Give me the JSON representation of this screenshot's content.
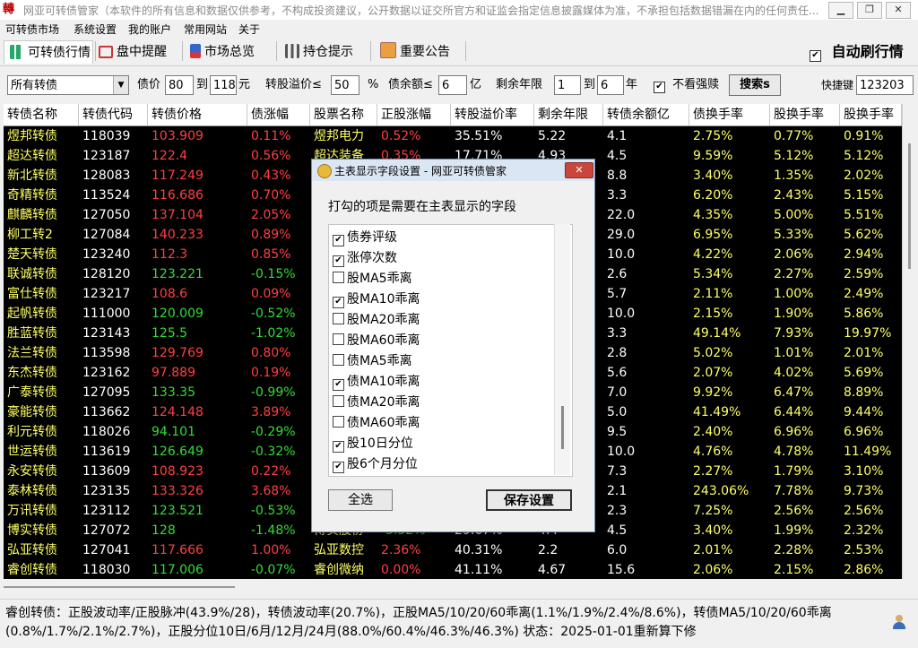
{
  "window": {
    "app_icon_text": "轉",
    "title": "网亚可转债管家（本软件的所有信息和数据仅供参考，不构成投资建议，公开数据以证交所官方和证监会指定信息披露媒体为准，不承担包括数据错漏在内的任何责任..."
  },
  "menu": [
    "可转债市场",
    "系统设置",
    "我的账户",
    "常用网站",
    "关于"
  ],
  "tabs": [
    {
      "label": "可转债行情",
      "icon": "bar-chart-icon"
    },
    {
      "label": "盘中提醒",
      "icon": "monitor-alert-icon"
    },
    {
      "label": "市场总览",
      "icon": "market-chart-icon"
    },
    {
      "label": "持仓提示",
      "icon": "portfolio-icon"
    },
    {
      "label": "重要公告",
      "icon": "announcement-icon"
    }
  ],
  "auto_refresh": {
    "label": "自动刷行情",
    "checked": true
  },
  "filters": {
    "category": "所有转债",
    "price_label": "债价",
    "price_min": "80",
    "price_to": "到",
    "price_max": "118",
    "price_unit": "元",
    "premium_label": "转股溢价≤",
    "premium_value": "50",
    "premium_unit": "%",
    "balance_label": "债余额≤",
    "balance_value": "6",
    "balance_unit": "亿",
    "years_label": "剩余年限",
    "years_min": "1",
    "years_to": "到",
    "years_max": "6",
    "years_unit": "年",
    "exclude_redeem_label": "不看强赎",
    "exclude_redeem_checked": true,
    "search_button": "搜索s",
    "shortcut_label": "快捷键",
    "shortcut_value": "123203"
  },
  "table": {
    "columns": [
      "转债名称",
      "转债代码",
      "转债价格",
      "债涨幅",
      "股票名称",
      "正股涨幅",
      "转股溢价率",
      "剩余年限",
      "转债余额亿",
      "债换手率",
      "股换手率",
      "股换手率"
    ],
    "rows": [
      [
        "煜邦转债",
        "118039",
        "103.909",
        "0.11%",
        "煜邦电力",
        "0.52%",
        "35.51%",
        "5.22",
        "4.1",
        "2.75%",
        "0.77%",
        "0.91%"
      ],
      [
        "超达转债",
        "123187",
        "122.4",
        "0.56%",
        "超达装备",
        "0.35%",
        "17.71%",
        "4.93",
        "4.5",
        "9.59%",
        "5.12%",
        "5.12%"
      ],
      [
        "新北转债",
        "128083",
        "117.249",
        "0.43%",
        "",
        "",
        "",
        "",
        "8.8",
        "3.40%",
        "1.35%",
        "2.02%"
      ],
      [
        "奇精转债",
        "113524",
        "116.686",
        "0.70%",
        "",
        "",
        "",
        "",
        "3.3",
        "6.20%",
        "2.43%",
        "5.15%"
      ],
      [
        "麒麟转债",
        "127050",
        "137.104",
        "2.05%",
        "",
        "",
        "",
        "",
        "22.0",
        "4.35%",
        "5.00%",
        "5.51%"
      ],
      [
        "柳工转2",
        "127084",
        "140.233",
        "0.89%",
        "",
        "",
        "",
        "",
        "29.0",
        "6.95%",
        "5.33%",
        "5.62%"
      ],
      [
        "楚天转债",
        "123240",
        "112.3",
        "0.85%",
        "",
        "",
        "",
        "",
        "10.0",
        "4.22%",
        "2.06%",
        "2.94%"
      ],
      [
        "联诚转债",
        "128120",
        "123.221",
        "-0.15%",
        "",
        "",
        "",
        "",
        "2.6",
        "5.34%",
        "2.27%",
        "2.59%"
      ],
      [
        "富仕转债",
        "123217",
        "108.6",
        "0.09%",
        "",
        "",
        "",
        "",
        "5.7",
        "2.11%",
        "1.00%",
        "2.49%"
      ],
      [
        "起帆转债",
        "111000",
        "120.009",
        "-0.52%",
        "",
        "",
        "",
        "",
        "10.0",
        "2.15%",
        "1.90%",
        "5.86%"
      ],
      [
        "胜蓝转债",
        "123143",
        "125.5",
        "-1.02%",
        "",
        "",
        "",
        "",
        "3.3",
        "49.14%",
        "7.93%",
        "19.97%"
      ],
      [
        "法兰转债",
        "113598",
        "129.769",
        "0.80%",
        "",
        "",
        "",
        "",
        "2.8",
        "5.02%",
        "1.01%",
        "2.01%"
      ],
      [
        "东杰转债",
        "123162",
        "97.889",
        "0.19%",
        "",
        "",
        "",
        "",
        "5.6",
        "2.07%",
        "4.02%",
        "5.69%"
      ],
      [
        "广泰转债",
        "127095",
        "133.35",
        "-0.99%",
        "",
        "",
        "",
        "",
        "7.0",
        "9.92%",
        "6.47%",
        "8.89%"
      ],
      [
        "豪能转债",
        "113662",
        "124.148",
        "3.89%",
        "",
        "",
        "",
        "",
        "5.0",
        "41.49%",
        "6.44%",
        "9.44%"
      ],
      [
        "利元转债",
        "118026",
        "94.101",
        "-0.29%",
        "",
        "",
        "",
        "",
        "9.5",
        "2.40%",
        "6.96%",
        "6.96%"
      ],
      [
        "世运转债",
        "113619",
        "126.649",
        "-0.32%",
        "",
        "",
        "",
        "",
        "10.0",
        "4.76%",
        "4.78%",
        "11.49%"
      ],
      [
        "永安转债",
        "113609",
        "108.923",
        "0.22%",
        "",
        "",
        "",
        "",
        "7.3",
        "2.27%",
        "1.79%",
        "3.10%"
      ],
      [
        "泰林转债",
        "123135",
        "133.326",
        "3.68%",
        "",
        "",
        "",
        "",
        "2.1",
        "243.06%",
        "7.78%",
        "9.73%"
      ],
      [
        "万讯转债",
        "123112",
        "123.521",
        "-0.53%",
        "",
        "",
        "",
        "",
        "2.3",
        "7.25%",
        "2.56%",
        "2.56%"
      ],
      [
        "博实转债",
        "127072",
        "128",
        "-1.48%",
        "博实股份",
        "-3.32%",
        "29.67%",
        "4.4",
        "4.5",
        "3.40%",
        "1.99%",
        "2.32%"
      ],
      [
        "弘亚转债",
        "127041",
        "117.666",
        "1.00%",
        "弘亚数控",
        "2.36%",
        "40.31%",
        "2.2",
        "6.0",
        "2.01%",
        "2.28%",
        "2.53%"
      ],
      [
        "睿创转债",
        "118030",
        "117.006",
        "-0.07%",
        "睿创微纳",
        "0.00%",
        "41.11%",
        "4.67",
        "15.6",
        "2.06%",
        "2.15%",
        "2.86%"
      ]
    ]
  },
  "status": {
    "line1": "睿创转债：正股波动率/正股脉冲(43.9%/28)，转债波动率(20.7%)，正股MA5/10/20/60乖离(1.1%/1.9%/2.4%/8.6%)，转债MA5/10/20/60乖离",
    "line2": "(0.8%/1.7%/2.1%/2.7%)，正股分位10日/6月/12月/24月(88.0%/60.4%/46.3%/46.3%) 状态：2025-01-01重新算下修"
  },
  "dialog": {
    "title": "主表显示字段设置 - 网亚可转债管家",
    "instruction": "打勾的项是需要在主表显示的字段",
    "items": [
      {
        "label": "债券评级",
        "checked": true
      },
      {
        "label": "涨停次数",
        "checked": true
      },
      {
        "label": "股MA5乖离",
        "checked": false
      },
      {
        "label": "股MA10乖离",
        "checked": true
      },
      {
        "label": "股MA20乖离",
        "checked": false
      },
      {
        "label": "股MA60乖离",
        "checked": false
      },
      {
        "label": "债MA5乖离",
        "checked": false
      },
      {
        "label": "债MA10乖离",
        "checked": true
      },
      {
        "label": "债MA20乖离",
        "checked": false
      },
      {
        "label": "债MA60乖离",
        "checked": false
      },
      {
        "label": "股10日分位",
        "checked": true
      },
      {
        "label": "股6个月分位",
        "checked": true
      }
    ],
    "select_all": "全选",
    "save": "保存设置"
  }
}
